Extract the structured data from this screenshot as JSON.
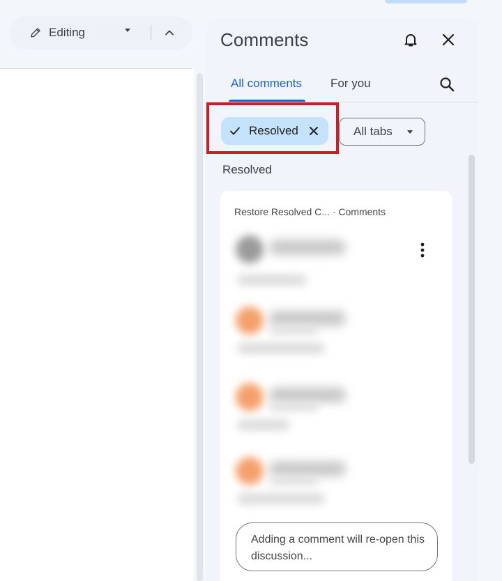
{
  "toolbar": {
    "mode_label": "Editing",
    "icons": {
      "mode": "pencil-icon",
      "dropdown": "caret-down-icon",
      "collapse": "chevron-up-icon"
    }
  },
  "comments_panel": {
    "title": "Comments",
    "icons": {
      "notifications": "bell-icon",
      "close": "close-icon",
      "search": "search-icon"
    },
    "tabs": [
      {
        "label": "All comments",
        "selected": true
      },
      {
        "label": "For you",
        "selected": false
      }
    ],
    "filters": {
      "resolved_chip": {
        "label": "Resolved",
        "active": true
      },
      "tabs_dropdown": {
        "label": "All tabs"
      }
    },
    "section_label": "Resolved",
    "thread": {
      "header": "Restore Resolved C... · Comments",
      "reply_placeholder": "Adding a comment will re-open this discussion..."
    }
  },
  "colors": {
    "accent": "#1a62c4",
    "chip_active_bg": "#c4e3fb",
    "highlight_border": "#cc1d23",
    "avatar_orange": "#f5a06b",
    "avatar_gray": "#9a9a9a"
  }
}
